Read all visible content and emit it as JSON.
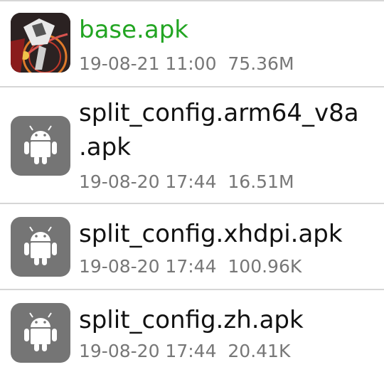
{
  "files": [
    {
      "name_lines": [
        "base.apk"
      ],
      "date": "19-08-21 11:00",
      "size": "75.36M",
      "icon": "game-app-icon",
      "name_color": "#22a522"
    },
    {
      "name_lines": [
        "split_config.arm64_v8a",
        ".apk"
      ],
      "date": "19-08-20 17:44",
      "size": "16.51M",
      "icon": "android-icon",
      "name_color": "#111111"
    },
    {
      "name_lines": [
        "split_config.xhdpi.apk"
      ],
      "date": "19-08-20 17:44",
      "size": "100.96K",
      "icon": "android-icon",
      "name_color": "#111111"
    },
    {
      "name_lines": [
        "split_config.zh.apk"
      ],
      "date": "19-08-20 17:44",
      "size": "20.41K",
      "icon": "android-icon",
      "name_color": "#111111"
    }
  ],
  "colors": {
    "accent": "#22a522",
    "icon_gray": "#757575",
    "meta_gray": "#777777",
    "divider": "#d6d6d6"
  }
}
